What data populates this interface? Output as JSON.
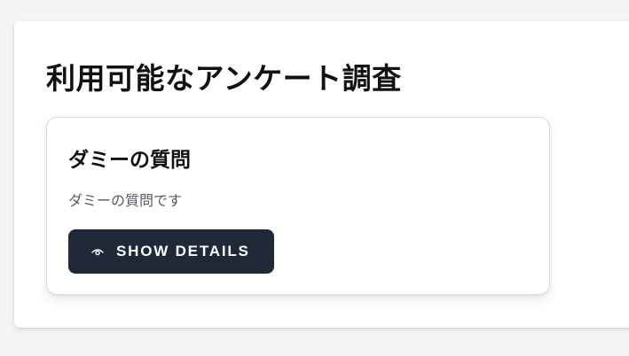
{
  "page": {
    "title": "利用可能なアンケート調査"
  },
  "survey_card": {
    "title": "ダミーの質問",
    "description": "ダミーの質問です",
    "button_label": "SHOW DETAILS",
    "button_icon": "eye-icon"
  },
  "colors": {
    "background": "#f3f4f6",
    "button_bg": "#1f2937",
    "button_text": "#ffffff"
  }
}
